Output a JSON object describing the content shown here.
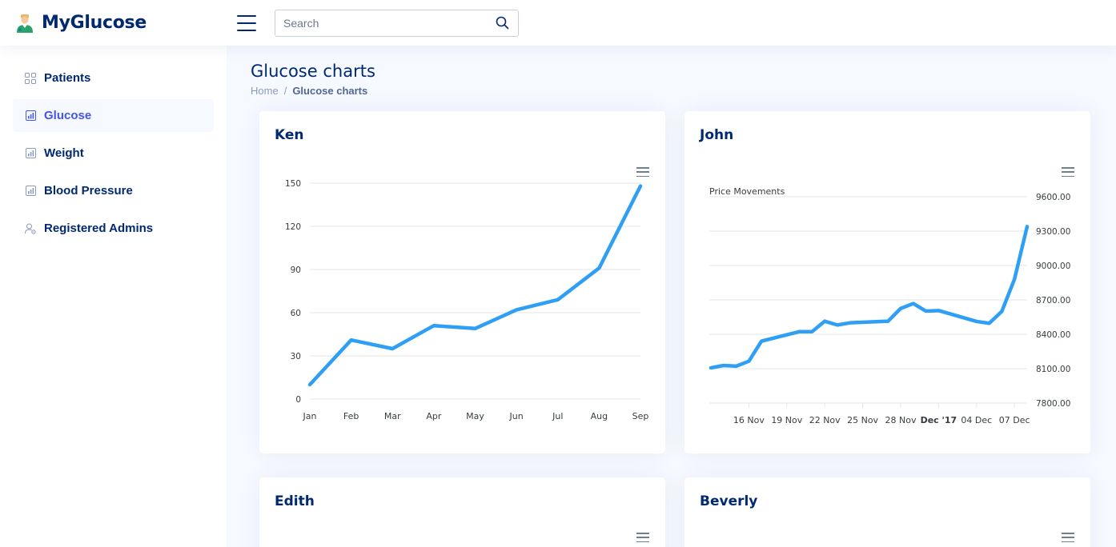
{
  "app": {
    "name": "MyGlucose"
  },
  "search": {
    "placeholder": "Search"
  },
  "sidebar": {
    "items": [
      {
        "label": "Patients",
        "icon": "grid-icon",
        "active": false
      },
      {
        "label": "Glucose",
        "icon": "bar-chart-icon",
        "active": true
      },
      {
        "label": "Weight",
        "icon": "bar-chart-icon",
        "active": false
      },
      {
        "label": "Blood Pressure",
        "icon": "bar-chart-icon",
        "active": false
      },
      {
        "label": "Registered Admins",
        "icon": "person-gear-icon",
        "active": false
      }
    ]
  },
  "page": {
    "title": "Glucose charts"
  },
  "breadcrumb": {
    "home": "Home",
    "separator": "/",
    "current": "Glucose charts"
  },
  "colors": {
    "primary": "#012970",
    "accent": "#4154f1",
    "line": "#2e9ff5",
    "grid": "#e6e6e6"
  },
  "cards": [
    {
      "title": "Ken"
    },
    {
      "title": "John"
    },
    {
      "title": "Edith"
    },
    {
      "title": "Beverly"
    }
  ],
  "chart_data": [
    {
      "type": "line",
      "name": "Ken",
      "categories": [
        "Jan",
        "Feb",
        "Mar",
        "Apr",
        "May",
        "Jun",
        "Jul",
        "Aug",
        "Sep"
      ],
      "values": [
        10,
        41,
        35,
        51,
        49,
        62,
        69,
        91,
        148
      ],
      "yticks": [
        "0",
        "30",
        "60",
        "90",
        "120",
        "150"
      ],
      "ylim": [
        0,
        150
      ],
      "grid": true
    },
    {
      "type": "line",
      "name": "John",
      "title": "Price Movements",
      "xticks": [
        {
          "label": "16 Nov",
          "bold": false
        },
        {
          "label": "19 Nov",
          "bold": false
        },
        {
          "label": "22 Nov",
          "bold": false
        },
        {
          "label": "25 Nov",
          "bold": false
        },
        {
          "label": "28 Nov",
          "bold": false
        },
        {
          "label": "Dec '17",
          "bold": true
        },
        {
          "label": "04 Dec",
          "bold": false
        },
        {
          "label": "07 Dec",
          "bold": false
        }
      ],
      "yticks": [
        "7800.00",
        "8100.00",
        "8400.00",
        "8700.00",
        "9000.00",
        "9300.00",
        "9600.00"
      ],
      "ylim": [
        7800,
        9600
      ],
      "y_axis_side": "right",
      "grid": true,
      "x": [
        "2017-11-13",
        "2017-11-14",
        "2017-11-15",
        "2017-11-16",
        "2017-11-17",
        "2017-11-20",
        "2017-11-21",
        "2017-11-22",
        "2017-11-23",
        "2017-11-24",
        "2017-11-27",
        "2017-11-28",
        "2017-11-29",
        "2017-11-30",
        "2017-12-01",
        "2017-12-04",
        "2017-12-05",
        "2017-12-06",
        "2017-12-07",
        "2017-12-08"
      ],
      "values": [
        8107,
        8128,
        8122,
        8165,
        8340,
        8423,
        8423,
        8514,
        8481,
        8500,
        8514,
        8625,
        8668,
        8602,
        8607,
        8512,
        8496,
        8600,
        8881,
        9340
      ]
    }
  ]
}
